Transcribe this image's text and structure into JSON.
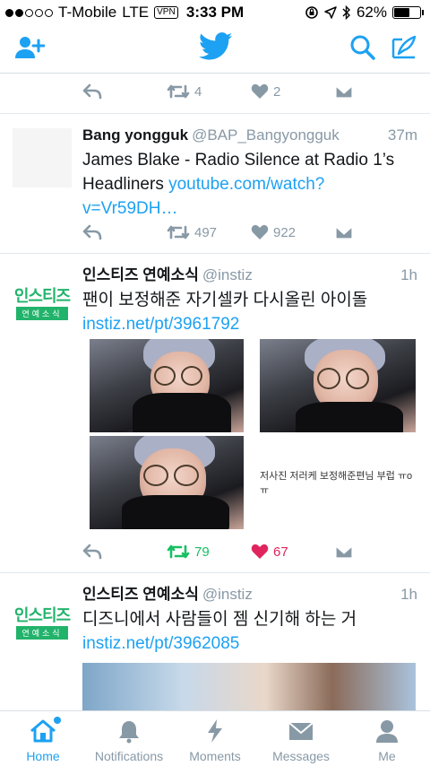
{
  "status_bar": {
    "carrier": "T-Mobile",
    "network": "LTE",
    "vpn": "VPN",
    "time": "3:33 PM",
    "battery": "62%",
    "battery_level": 0.62
  },
  "nav": {
    "icons": [
      "add-user-icon",
      "twitter-bird-icon",
      "search-icon",
      "compose-icon"
    ]
  },
  "tweets": [
    {
      "retweets": "4",
      "likes": "2"
    },
    {
      "name": "Bang yongguk",
      "handle": "@BAP_Bangyongguk",
      "time": "37m",
      "text": "James Blake - Radio Silence at Radio 1’s Headliners",
      "link": "youtube.com/watch?v=Vr59DH…",
      "retweets": "497",
      "likes": "922"
    },
    {
      "name": "인스티즈 연예소식",
      "handle": "@instiz",
      "time": "1h",
      "text": "팬이 보정해준 자기셀카 다시올린 아이돌",
      "link": "instiz.net/pt/3961792",
      "avatar_logo": "인스티즈",
      "avatar_sub": "연예소식",
      "media_caption": "저사진 저러케 보정해준편님 부럽 ㅠoㅠ",
      "retweets": "79",
      "likes": "67",
      "retweeted": true,
      "liked": true
    },
    {
      "name": "인스티즈 연예소식",
      "handle": "@instiz",
      "time": "1h",
      "text": "디즈니에서 사람들이 젬 신기해 하는 거",
      "link": "instiz.net/pt/3962085",
      "avatar_logo": "인스티즈",
      "avatar_sub": "연예소식"
    }
  ],
  "tabs": [
    {
      "label": "Home",
      "icon": "home-icon",
      "active": true
    },
    {
      "label": "Notifications",
      "icon": "bell-icon"
    },
    {
      "label": "Moments",
      "icon": "lightning-icon"
    },
    {
      "label": "Messages",
      "icon": "envelope-icon"
    },
    {
      "label": "Me",
      "icon": "person-icon"
    }
  ],
  "colors": {
    "accent": "#1da1f2",
    "retweet_active": "#17bf63",
    "like_active": "#e0245e",
    "muted": "#8899a6"
  }
}
